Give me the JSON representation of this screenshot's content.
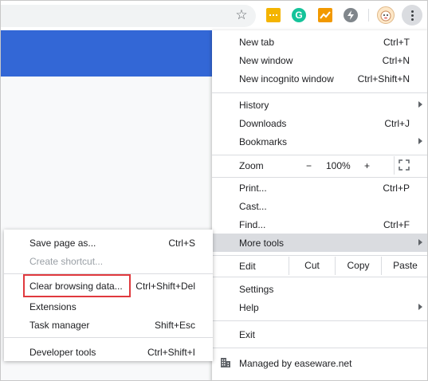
{
  "toolbar": {
    "icons": [
      "star-icon",
      "extension-yellow-icon",
      "grammarly-icon",
      "chart-extension-icon",
      "bolt-extension-icon",
      "profile-avatar",
      "more-menu-icon"
    ],
    "grammarly_letter": "G"
  },
  "main_menu": {
    "new_tab": {
      "label": "New tab",
      "shortcut": "Ctrl+T"
    },
    "new_window": {
      "label": "New window",
      "shortcut": "Ctrl+N"
    },
    "new_incognito": {
      "label": "New incognito window",
      "shortcut": "Ctrl+Shift+N"
    },
    "history": {
      "label": "History"
    },
    "downloads": {
      "label": "Downloads",
      "shortcut": "Ctrl+J"
    },
    "bookmarks": {
      "label": "Bookmarks"
    },
    "zoom": {
      "label": "Zoom",
      "minus": "−",
      "value": "100%",
      "plus": "+"
    },
    "print": {
      "label": "Print...",
      "shortcut": "Ctrl+P"
    },
    "cast": {
      "label": "Cast..."
    },
    "find": {
      "label": "Find...",
      "shortcut": "Ctrl+F"
    },
    "more_tools": {
      "label": "More tools"
    },
    "edit": {
      "label": "Edit",
      "cut": "Cut",
      "copy": "Copy",
      "paste": "Paste"
    },
    "settings": {
      "label": "Settings"
    },
    "help": {
      "label": "Help"
    },
    "exit": {
      "label": "Exit"
    },
    "managed": {
      "label": "Managed by easeware.net"
    }
  },
  "sub_menu": {
    "save_page": {
      "label": "Save page as...",
      "shortcut": "Ctrl+S"
    },
    "create_shortcut": {
      "label": "Create shortcut..."
    },
    "clear_data": {
      "label": "Clear browsing data...",
      "shortcut": "Ctrl+Shift+Del"
    },
    "extensions": {
      "label": "Extensions"
    },
    "task_manager": {
      "label": "Task manager",
      "shortcut": "Shift+Esc"
    },
    "developer_tools": {
      "label": "Developer tools",
      "shortcut": "Ctrl+Shift+I"
    }
  },
  "colors": {
    "banner": "#3367d6",
    "highlight_box": "#e0393e",
    "hover": "#dadce0"
  }
}
